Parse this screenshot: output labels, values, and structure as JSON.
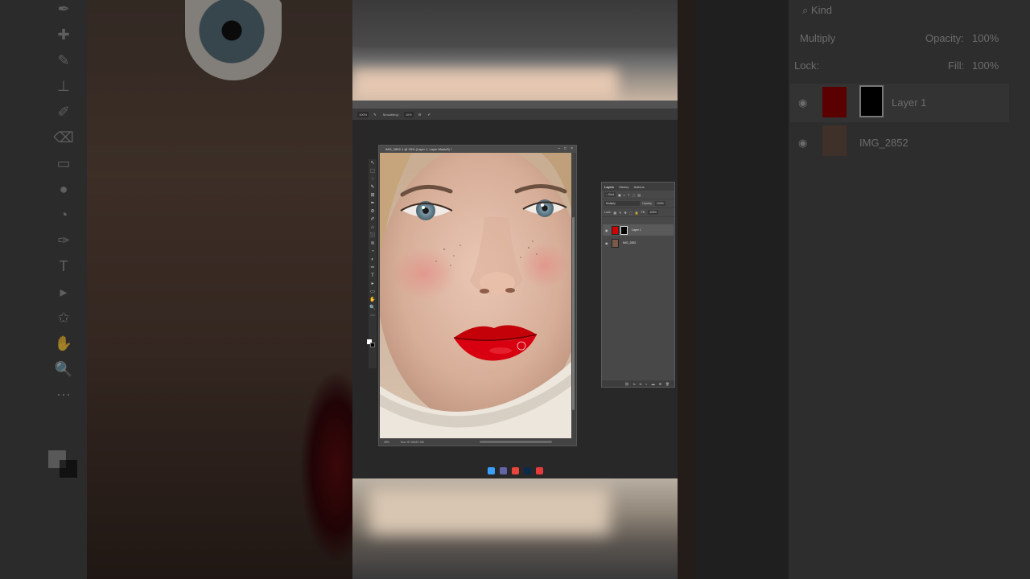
{
  "background": {
    "left_tools": [
      "dropper-icon",
      "bandage-icon",
      "brush-icon",
      "stamp-icon",
      "history-brush-icon",
      "eraser-icon",
      "gradient-icon",
      "blur-icon",
      "dodge-icon",
      "pen-icon",
      "type-icon",
      "select-icon",
      "shape-icon",
      "hand-icon",
      "zoom-icon",
      "more-icon"
    ],
    "right_panel": {
      "kind_label": "Kind",
      "blend_mode": "Multiply",
      "opacity_label": "Opacity:",
      "opacity_value": "100%",
      "lock_label": "Lock:",
      "fill_label": "Fill:",
      "fill_value": "100%",
      "layers": [
        "Layer 1",
        "IMG_2852"
      ]
    }
  },
  "options_bar": {
    "size": "100%",
    "smoothing_label": "Smoothing:",
    "smoothing_value": "10%"
  },
  "document": {
    "title": "IMG_2852-1 @ 25% (Layer 1, Layer Mask/8) *",
    "window_buttons": [
      "–",
      "□",
      "×"
    ],
    "zoom": "25%",
    "doc_size": "Doc: 57.0M/57.0M"
  },
  "tools": [
    "↖",
    "⬚",
    "◌",
    "✎",
    "⊞",
    "✒",
    "⊘",
    "✐",
    "⌂",
    "⬛",
    "≋",
    "◔",
    "◐",
    "✑",
    "T",
    "▸",
    "▭",
    "✋",
    "🔍",
    "⋯"
  ],
  "layers_panel": {
    "tabs": [
      "Layers",
      "History",
      "Actions"
    ],
    "active_tab": "Layers",
    "kind_label": "Kind",
    "blend_mode": "Multiply",
    "opacity_label": "Opacity:",
    "opacity_value": "100%",
    "lock_label": "Lock:",
    "fill_label": "Fill:",
    "fill_value": "100%",
    "layers": [
      {
        "name": "Layer 1",
        "color": "#d40000",
        "selected": true
      },
      {
        "name": "IMG_2852",
        "color": "#7b5a4a",
        "selected": false
      }
    ],
    "footer_icons": [
      "link-icon",
      "fx-icon",
      "mask-icon",
      "adjustment-icon",
      "folder-icon",
      "new-layer-icon",
      "trash-icon"
    ]
  },
  "taskbar": {
    "apps": [
      {
        "name": "windows-start",
        "color": "#3aa0ff"
      },
      {
        "name": "teams",
        "color": "#6264a7"
      },
      {
        "name": "chrome",
        "color": "#e8453c"
      },
      {
        "name": "photoshop",
        "color": "#0a2a4a"
      },
      {
        "name": "app-red",
        "color": "#e63b3b"
      }
    ]
  },
  "colors": {
    "lip_red": "#d0000a",
    "panel_bg": "#484848",
    "app_bg": "#282828"
  }
}
